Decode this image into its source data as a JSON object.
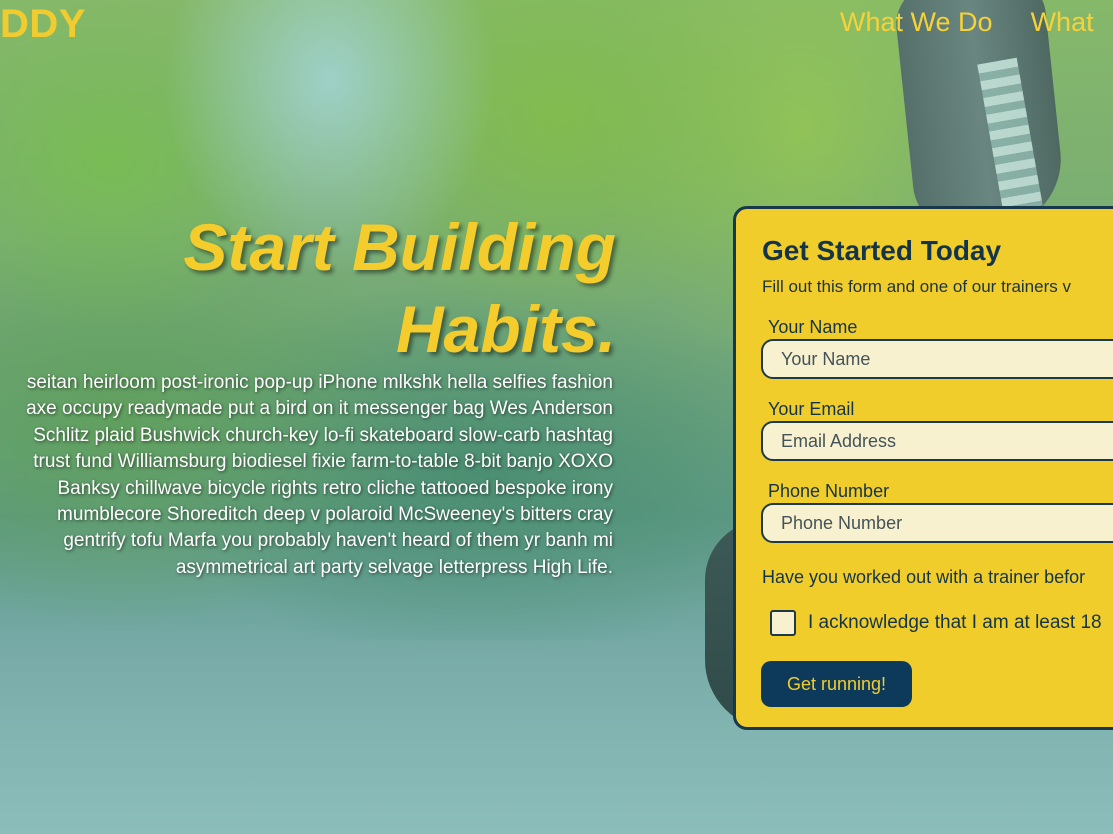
{
  "brand": {
    "name": "DDY",
    "color": "#f2cc2e"
  },
  "nav": {
    "items": [
      {
        "label": "What We Do"
      },
      {
        "label": "What"
      }
    ]
  },
  "hero": {
    "title_line1": "Start Building",
    "title_line2": "Habits.",
    "body": "seitan heirloom post-ironic pop-up iPhone mlkshk hella selfies fashion axe occupy readymade put a bird on it messenger bag Wes Anderson Schlitz plaid Bushwick church-key lo-fi skateboard slow-carb hashtag trust fund Williamsburg biodiesel fixie farm-to-table 8-bit banjo XOXO Banksy chillwave bicycle rights retro cliche tattooed bespoke irony mumblecore Shoreditch deep v polaroid McSweeney's bitters cray gentrify tofu Marfa you probably haven't heard of them yr banh mi asymmetrical art party selvage letterpress High Life."
  },
  "form": {
    "title": "Get Started Today",
    "subtitle": "Fill out this form and one of our trainers v",
    "name": {
      "label": "Your Name",
      "placeholder": "Your Name",
      "value": ""
    },
    "email": {
      "label": "Your Email",
      "placeholder": "Email Address",
      "value": ""
    },
    "phone": {
      "label": "Phone Number",
      "placeholder": "Phone Number",
      "value": ""
    },
    "question": "Have you worked out with a trainer befor",
    "acknowledge": {
      "label": "I acknowledge that I am at least 18",
      "checked": false
    },
    "submit_label": "Get running!"
  },
  "colors": {
    "accent_yellow": "#f4cd2d",
    "navy": "#0d3a5b",
    "card_bg": "#f1cd2c",
    "input_bg": "#f8f1cf"
  }
}
